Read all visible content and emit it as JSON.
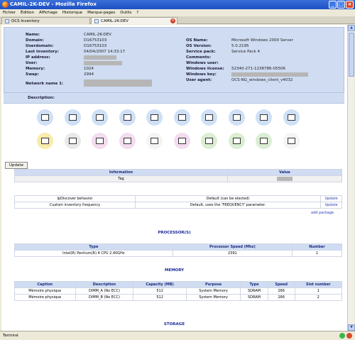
{
  "window": {
    "title": "CAMIL-2K-DEV - Mozilla Firefox"
  },
  "menu": [
    "Fichier",
    "Édition",
    "Affichage",
    "Historique",
    "Marque-pages",
    "Outils",
    "?"
  ],
  "tabs": [
    {
      "label": "OCS Inventory",
      "active": false
    },
    {
      "label": "CAMIL-2K-DEV",
      "active": true
    }
  ],
  "computer": {
    "left": [
      {
        "label": "Name:",
        "value": "CAMIL-2K-DEV"
      },
      {
        "label": "Domain:",
        "value": "D16753103"
      },
      {
        "label": "Userdomain:",
        "value": "D16753103"
      },
      {
        "label": "Last inventory:",
        "value": "04/04/2007 14:33:17"
      },
      {
        "label": "IP address:",
        "value": ""
      },
      {
        "label": "User:",
        "value": ""
      },
      {
        "label": "Memory:",
        "value": "1024"
      },
      {
        "label": "Swap:",
        "value": "2994"
      },
      {
        "label": "Network name 1:",
        "value": ""
      }
    ],
    "right": [
      {
        "label": "OS Name:",
        "value": "Microsoft Windows 2000 Server"
      },
      {
        "label": "OS Version:",
        "value": "5.0.2195"
      },
      {
        "label": "Service pack:",
        "value": "Service Pack 4"
      },
      {
        "label": "Comments:",
        "value": ""
      },
      {
        "label": "Windows user:",
        "value": ""
      },
      {
        "label": "Windows license:",
        "value": "52340-271-1238786-05506"
      },
      {
        "label": "Windows key:",
        "value": ""
      },
      {
        "label": "User agent:",
        "value": "OCS-NG_windows_client_v4032"
      }
    ]
  },
  "description_label": "Description:",
  "icon_row1": [
    "processor-icon",
    "memory-icon",
    "storage-icon",
    "harddrive-icon",
    "display-icon",
    "network-icon",
    "input-device-icon",
    "port-icon",
    "software-icon",
    "printer-icon"
  ],
  "icon_row2": [
    "registry-icon",
    "tools-icon",
    "controller-icon",
    "folder-icon",
    "group-icon",
    "config-icon",
    "monitor-icon",
    "admin-icon",
    "package-icon",
    "modem-icon"
  ],
  "colors": {
    "accent": "#cfdcf2",
    "link": "#2a3fb8",
    "header_text": "#1a2a7a"
  },
  "update_button": "Update",
  "admin_table": {
    "headers": [
      "Information",
      "Value"
    ],
    "rows": [
      [
        "Tag",
        ""
      ]
    ]
  },
  "options_table": {
    "rows": [
      {
        "name": "IpDiscover behavior",
        "value": "Default (can be elected)",
        "action": "Update"
      },
      {
        "name": "Custom inventory frequency",
        "value": "Default, uses the 'FREQUENCY' parameter.",
        "action": "Update"
      }
    ],
    "add_package": "add package"
  },
  "processors": {
    "title": "PROCESSOR(S)",
    "headers": [
      "Type",
      "Processor Speed (Mhz)",
      "Number"
    ],
    "rows": [
      [
        "Intel(R) Pentium(R) 4 CPU 2.40GHz",
        "2391",
        "1"
      ]
    ]
  },
  "memory": {
    "title": "MEMORY",
    "headers": [
      "Caption",
      "Description",
      "Capacity (MB)",
      "Purpose",
      "Type",
      "Speed",
      "Slot number"
    ],
    "rows": [
      [
        "Mémoire physique",
        "DIMM_A (No ECC)",
        "512",
        "System Memory",
        "SDRAM",
        "266",
        "1"
      ],
      [
        "Mémoire physique",
        "DIMM_B (No ECC)",
        "512",
        "System Memory",
        "SDRAM",
        "266",
        "2"
      ]
    ]
  },
  "storage": {
    "title": "STORAGE"
  },
  "status": {
    "text": "Terminé"
  }
}
